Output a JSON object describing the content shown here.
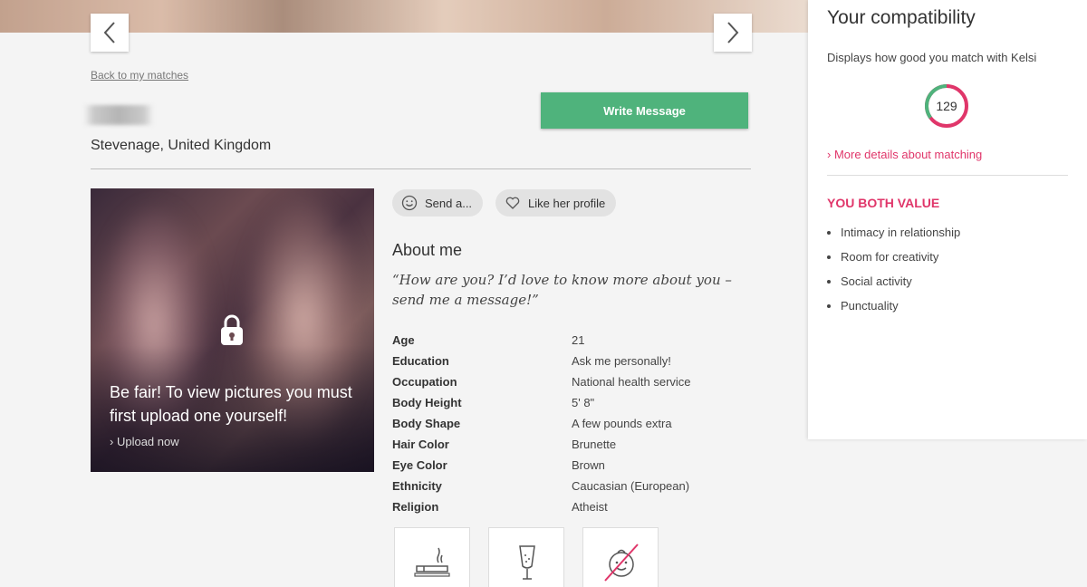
{
  "nav": {
    "back_link": "Back to my matches",
    "write_message": "Write Message"
  },
  "profile": {
    "location": "Stevenage, United Kingdom",
    "photo_message": "Be fair! To view pictures you must first upload one yourself!",
    "upload_link": "Upload now",
    "send_button": "Send a...",
    "like_button": "Like her profile",
    "about_title": "About me",
    "quote": "“How are you? I’d love to know more about you – send me a message!”",
    "details": [
      {
        "label": "Age",
        "value": "21"
      },
      {
        "label": "Education",
        "value": "Ask me personally!"
      },
      {
        "label": "Occupation",
        "value": "National health service"
      },
      {
        "label": "Body Height",
        "value": "5' 8\""
      },
      {
        "label": "Body Shape",
        "value": "A few pounds extra"
      },
      {
        "label": "Hair Color",
        "value": "Brunette"
      },
      {
        "label": "Eye Color",
        "value": "Brown"
      },
      {
        "label": "Ethnicity",
        "value": "Caucasian (European)"
      },
      {
        "label": "Religion",
        "value": "Atheist"
      }
    ],
    "habit_icons": [
      "cigarette-icon",
      "champagne-icon",
      "no-children-icon"
    ]
  },
  "compatibility": {
    "title": "Your compatibility",
    "subtitle": "Displays how good you match with Kelsi",
    "score": "129",
    "more_link": "More details about matching",
    "values_title": "YOU BOTH VALUE",
    "values": [
      "Intimacy in relationship",
      "Room for creativity",
      "Social activity",
      "Punctuality"
    ]
  },
  "colors": {
    "accent_green": "#4fb37c",
    "accent_pink": "#e0366a"
  }
}
